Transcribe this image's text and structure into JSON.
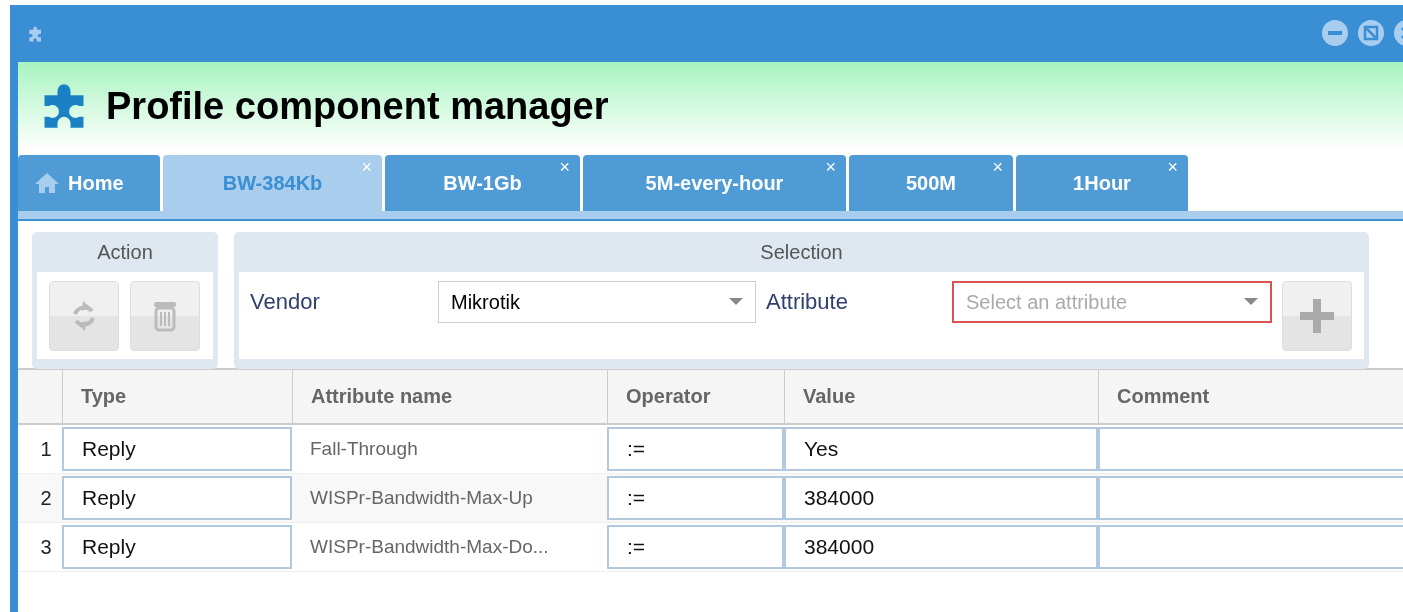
{
  "window": {
    "title": "Profile component manager"
  },
  "tabs": [
    {
      "label": "Home",
      "kind": "home",
      "selected": false,
      "closable": false
    },
    {
      "label": "BW-384Kb",
      "kind": "item",
      "selected": true,
      "closable": true
    },
    {
      "label": "BW-1Gb",
      "kind": "item",
      "selected": false,
      "closable": true
    },
    {
      "label": "5M-every-hour",
      "kind": "item",
      "selected": false,
      "closable": true
    },
    {
      "label": "500M",
      "kind": "item",
      "selected": false,
      "closable": true
    },
    {
      "label": "1Hour",
      "kind": "item",
      "selected": false,
      "closable": true
    }
  ],
  "close_glyph": "×",
  "action": {
    "title": "Action"
  },
  "selection": {
    "title": "Selection",
    "vendor_label": "Vendor",
    "vendor_value": "Mikrotik",
    "attribute_label": "Attribute",
    "attribute_placeholder": "Select an attribute"
  },
  "table": {
    "columns": [
      "Type",
      "Attribute name",
      "Operator",
      "Value",
      "Comment"
    ],
    "rows": [
      {
        "number": "1",
        "type": "Reply",
        "attribute": "Fall-Through",
        "operator": ":=",
        "value": "Yes",
        "comment": ""
      },
      {
        "number": "2",
        "type": "Reply",
        "attribute": "WISPr-Bandwidth-Max-Up",
        "operator": ":=",
        "value": "384000",
        "comment": ""
      },
      {
        "number": "3",
        "type": "Reply",
        "attribute": "WISPr-Bandwidth-Max-Do...",
        "operator": ":=",
        "value": "384000",
        "comment": ""
      }
    ]
  }
}
